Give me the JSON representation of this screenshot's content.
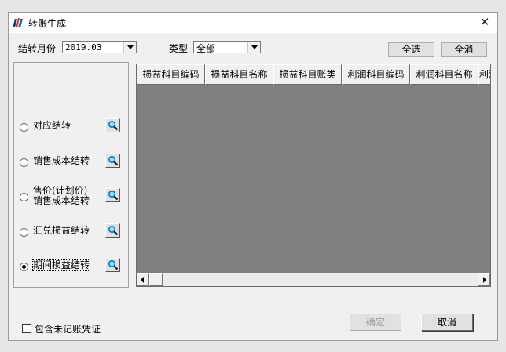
{
  "window": {
    "title": "转账生成",
    "close_glyph": "✕"
  },
  "filters": {
    "month_label": "结转月份",
    "month_value": "2019.03",
    "type_label": "类型",
    "type_value": "全部"
  },
  "actions": {
    "select_all": "全选",
    "deselect_all": "全消",
    "confirm": "确定",
    "cancel": "取消"
  },
  "options": [
    {
      "label": "对应结转",
      "selected": false
    },
    {
      "label": "销售成本结转",
      "selected": false
    },
    {
      "label": "售价(计划价)\n销售成本结转",
      "selected": false
    },
    {
      "label": "汇兑损益结转",
      "selected": false
    },
    {
      "label": "期间损益结转",
      "selected": true
    }
  ],
  "grid": {
    "columns": [
      "损益科目编码",
      "损益科目名称",
      "损益科目账类",
      "利润科目编码",
      "利润科目名称",
      "利润"
    ],
    "rows": []
  },
  "include_unposted": {
    "label": "包含未记账凭证",
    "checked": false
  },
  "colors": {
    "grid_background": "#808080",
    "dialog_bg": "#f0f0f0",
    "lookup_icon": "#00a0e0"
  },
  "icons": {
    "app": "book-icon",
    "lookup": "magnifier-icon",
    "close": "close-icon"
  }
}
